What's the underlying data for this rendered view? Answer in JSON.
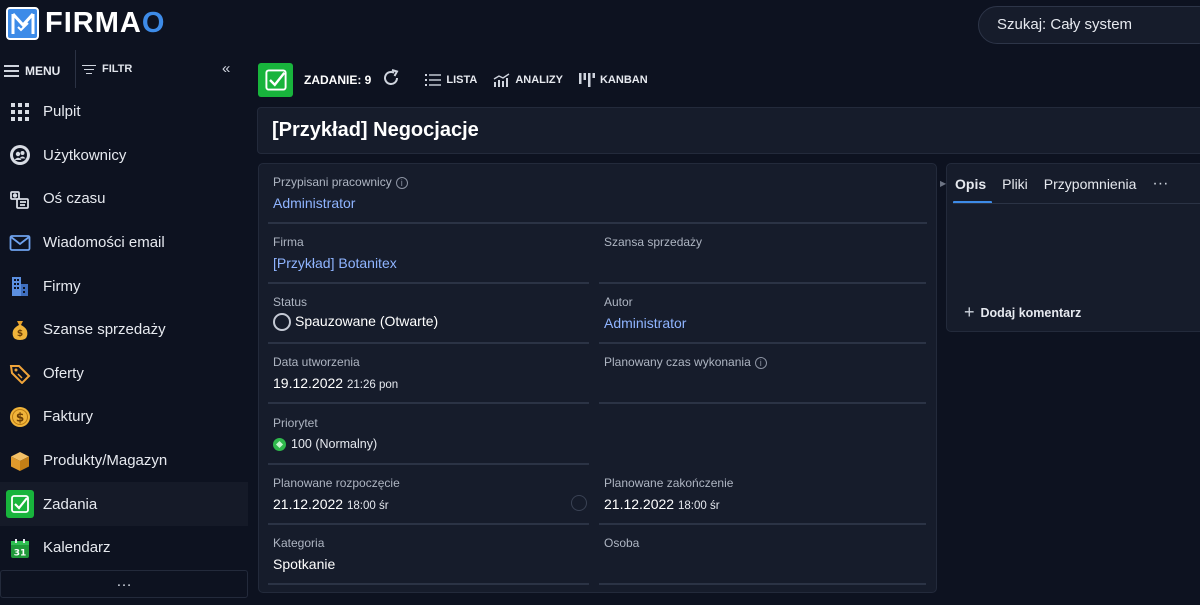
{
  "app": {
    "logo_text_main": "FIRMA",
    "logo_text_end": "O",
    "search_label": "Szukaj: Cały system"
  },
  "sidebar": {
    "menu_label": "MENU",
    "filter_label": "FILTR",
    "collapse_glyph": "«",
    "more_glyph": "…",
    "items": [
      {
        "label": "Pulpit",
        "icon": "dashboard-grid-icon"
      },
      {
        "label": "Użytkownicy",
        "icon": "users-icon"
      },
      {
        "label": "Oś czasu",
        "icon": "timeline-icon"
      },
      {
        "label": "Wiadomości email",
        "icon": "email-icon"
      },
      {
        "label": "Firmy",
        "icon": "building-icon"
      },
      {
        "label": "Szanse sprzedaży",
        "icon": "money-bag-icon"
      },
      {
        "label": "Oferty",
        "icon": "tag-icon"
      },
      {
        "label": "Faktury",
        "icon": "dollar-coin-icon"
      },
      {
        "label": "Produkty/Magazyn",
        "icon": "box-icon"
      },
      {
        "label": "Zadania",
        "icon": "checkbox-icon",
        "active": true
      },
      {
        "label": "Kalendarz",
        "icon": "calendar-icon"
      }
    ]
  },
  "toolbar": {
    "task_title": "ZADANIE: 9",
    "list_label": "LISTA",
    "analytics_label": "ANALIZY",
    "kanban_label": "KANBAN"
  },
  "page_title": "[Przykład] Negocjacje",
  "form": {
    "assigned_label": "Przypisani pracownicy",
    "assigned_value": "Administrator",
    "company_label": "Firma",
    "company_value": "[Przykład] Botanitex",
    "opportunity_label": "Szansa sprzedaży",
    "opportunity_value": "",
    "status_label": "Status",
    "status_value": "Spauzowane (Otwarte)",
    "author_label": "Autor",
    "author_value": "Administrator",
    "created_label": "Data utworzenia",
    "created_date": "19.12.2022",
    "created_time": "21:26 pon",
    "planned_duration_label": "Planowany czas wykonania",
    "priority_label": "Priorytet",
    "priority_value": "100 (Normalny)",
    "planned_start_label": "Planowane rozpoczęcie",
    "planned_start_date": "21.12.2022",
    "planned_start_time": "18:00 śr",
    "planned_end_label": "Planowane zakończenie",
    "planned_end_date": "21.12.2022",
    "planned_end_time": "18:00 śr",
    "category_label": "Kategoria",
    "category_value": "Spotkanie",
    "person_label": "Osoba",
    "person_value": ""
  },
  "right_panel": {
    "tabs": [
      "Opis",
      "Pliki",
      "Przypomnienia"
    ],
    "more_glyph": "···",
    "add_comment_label": "Dodaj komentarz"
  },
  "colors": {
    "accent_blue": "#3d8be8",
    "task_green": "#18b43c",
    "link_blue": "#8fb4ff",
    "background": "#0d1220",
    "panel": "#161c2b"
  }
}
